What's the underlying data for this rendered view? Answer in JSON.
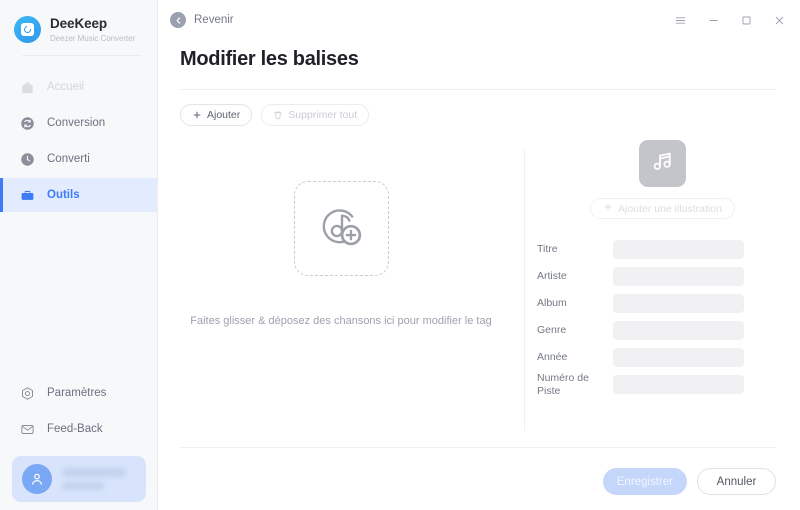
{
  "brand": {
    "name": "DeeKeep",
    "subtitle": "Deezer Music Converter",
    "logo_icon": "deezer-disc-icon",
    "accent": "#3d7bf7"
  },
  "sidebar": {
    "items": [
      {
        "label": "Accueil",
        "icon": "home-icon",
        "state": "disabled"
      },
      {
        "label": "Conversion",
        "icon": "convert-icon",
        "state": "default"
      },
      {
        "label": "Converti",
        "icon": "clock-icon",
        "state": "default"
      },
      {
        "label": "Outils",
        "icon": "toolbox-icon",
        "state": "active"
      }
    ],
    "bottom_items": [
      {
        "label": "Paramètres",
        "icon": "settings-icon"
      },
      {
        "label": "Feed-Back",
        "icon": "mail-icon"
      }
    ],
    "account": {
      "avatar_icon": "user-icon",
      "name": "",
      "plan": ""
    }
  },
  "titlebar": {
    "back_label": "Revenir",
    "back_icon": "arrow-left-circle-icon",
    "window_controls": [
      {
        "name": "menu-icon",
        "glyph": "hamburger"
      },
      {
        "name": "minimize-icon",
        "glyph": "minimize"
      },
      {
        "name": "maximize-icon",
        "glyph": "maximize"
      },
      {
        "name": "close-icon",
        "glyph": "close"
      }
    ]
  },
  "page": {
    "title": "Modifier les balises"
  },
  "toolbar": {
    "add_label": "Ajouter",
    "add_icon": "plus-icon",
    "delete_all_label": "Supprimer tout",
    "delete_all_icon": "trash-icon",
    "delete_all_disabled": true
  },
  "dropzone": {
    "icon": "add-music-icon",
    "hint": "Faites glisser & déposez des chansons ici pour modifier le tag"
  },
  "tag_panel": {
    "artwork_icon": "music-note-icon",
    "add_artwork_label": "Ajouter une illustration",
    "add_artwork_icon": "plus-icon",
    "fields": [
      {
        "label": "Titre",
        "value": "",
        "placeholder": ""
      },
      {
        "label": "Artiste",
        "value": "",
        "placeholder": ""
      },
      {
        "label": "Album",
        "value": "",
        "placeholder": ""
      },
      {
        "label": "Genre",
        "value": "",
        "placeholder": ""
      },
      {
        "label": "Année",
        "value": "",
        "placeholder": ""
      },
      {
        "label": "Numéro de Piste",
        "value": "",
        "placeholder": ""
      }
    ]
  },
  "footer": {
    "save_label": "Enregistrer",
    "save_disabled": true,
    "cancel_label": "Annuler"
  }
}
